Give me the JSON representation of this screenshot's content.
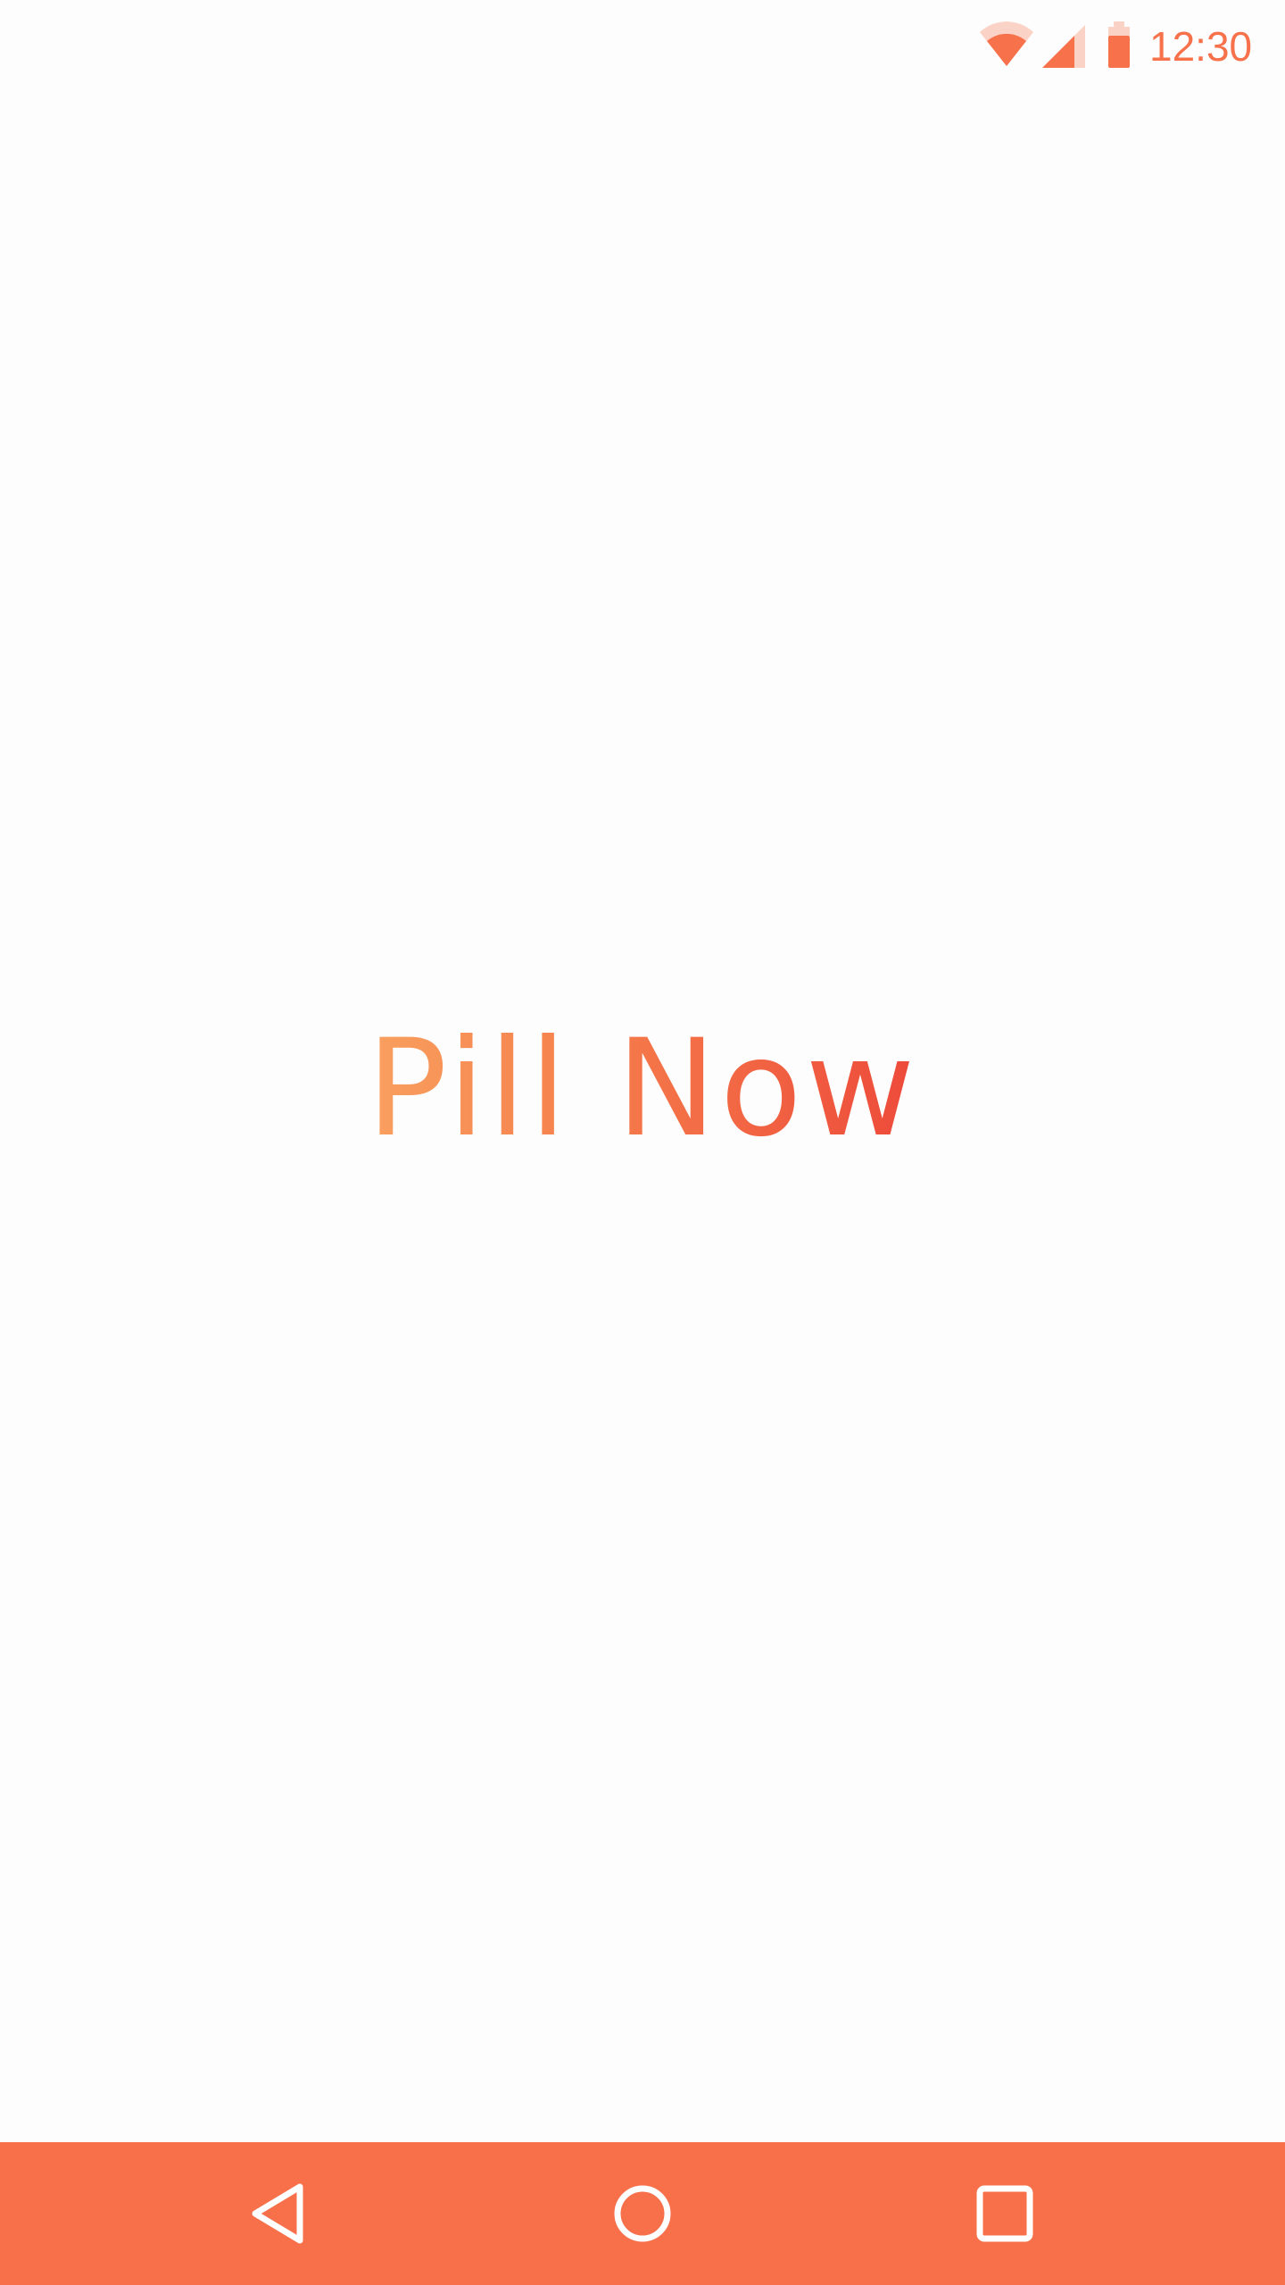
{
  "status_bar": {
    "time": "12:30",
    "icons": [
      "wifi-icon",
      "cell-signal-icon",
      "battery-icon"
    ],
    "color": "#f7714b"
  },
  "splash": {
    "title": "Pill Now",
    "gradient_colors": [
      "#f9a05f",
      "#f57a4a",
      "#ed4a3a"
    ]
  },
  "nav_bar": {
    "background": "#f8704a",
    "buttons": [
      "back-icon",
      "home-icon",
      "recents-icon"
    ]
  }
}
